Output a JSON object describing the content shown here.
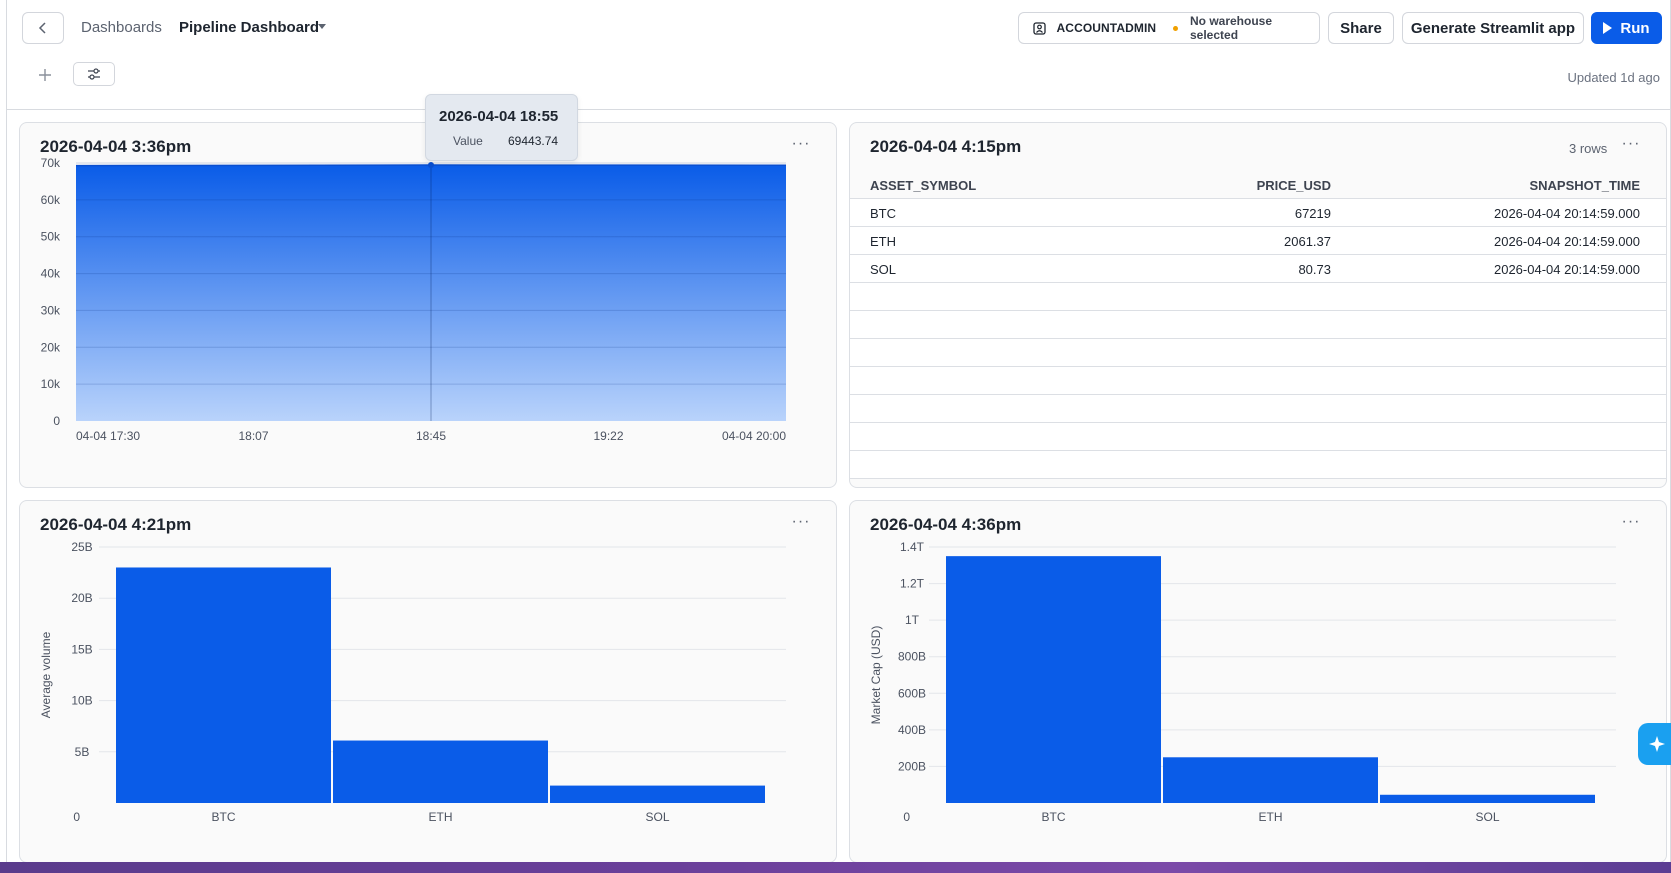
{
  "header": {
    "breadcrumb": "Dashboards",
    "dashboard_title": "Pipeline Dashboard",
    "role": "ACCOUNTADMIN",
    "warehouse": "No warehouse selected",
    "share_label": "Share",
    "streamlit_label": "Generate Streamlit app",
    "run_label": "Run",
    "updated": "Updated 1d ago"
  },
  "colors": {
    "accent": "#0a5ce8",
    "warehouse_dot": "#f0a000",
    "area_top": "#0a5ce8",
    "area_bottom": "#b9d3fb"
  },
  "icons": {
    "back": "chevron-left-icon",
    "role": "user-badge-icon",
    "run": "play-icon",
    "add": "plus-icon",
    "filter": "sliders-icon",
    "more": "more-horizontal-icon",
    "ai": "sparkle-icon"
  },
  "tooltip": {
    "title": "2026-04-04 18:55",
    "key": "Value",
    "value": "69443.74"
  },
  "cards": {
    "area": {
      "title": "2026-04-04 3:36pm",
      "more": "···"
    },
    "table": {
      "title": "2026-04-04 4:15pm",
      "rows_count": "3 rows",
      "more": "···",
      "columns": [
        "ASSET_SYMBOL",
        "PRICE_USD",
        "SNAPSHOT_TIME"
      ],
      "rows": [
        [
          "BTC",
          "67219",
          "2026-04-04 20:14:59.000"
        ],
        [
          "ETH",
          "2061.37",
          "2026-04-04 20:14:59.000"
        ],
        [
          "SOL",
          "80.73",
          "2026-04-04 20:14:59.000"
        ]
      ]
    },
    "volume": {
      "title": "2026-04-04 4:21pm",
      "more": "···"
    },
    "marketcap": {
      "title": "2026-04-04 4:36pm",
      "more": "···"
    }
  },
  "chart_data": [
    {
      "type": "area",
      "x": [
        "04-04 17:30",
        "18:07",
        "18:45",
        "19:22",
        "04-04 20:00"
      ],
      "x_ticks": [
        "04-04 17:30",
        "18:07",
        "18:45",
        "19:22",
        "04-04 20:00"
      ],
      "y_ticks": [
        "0",
        "10k",
        "20k",
        "30k",
        "40k",
        "50k",
        "60k",
        "70k"
      ],
      "values": [
        69300,
        69350,
        69443.74,
        69420,
        69390
      ],
      "ylim": [
        0,
        70000
      ],
      "xlabel": "",
      "ylabel": "",
      "grid": true
    },
    {
      "type": "bar",
      "categories": [
        "BTC",
        "ETH",
        "SOL"
      ],
      "values": [
        23000000000,
        6100000000,
        1700000000
      ],
      "y_ticks": [
        "0",
        "5B",
        "10B",
        "15B",
        "20B",
        "25B"
      ],
      "ylim": [
        0,
        25000000000
      ],
      "xlabel": "",
      "ylabel": "Average volume",
      "grid": true
    },
    {
      "type": "bar",
      "categories": [
        "BTC",
        "ETH",
        "SOL"
      ],
      "values": [
        1350000000000,
        250000000000,
        45000000000
      ],
      "y_ticks": [
        "0",
        "200B",
        "400B",
        "600B",
        "800B",
        "1T",
        "1.2T",
        "1.4T"
      ],
      "ylim": [
        0,
        1400000000000
      ],
      "xlabel": "",
      "ylabel": "Market Cap (USD)",
      "grid": true
    }
  ]
}
